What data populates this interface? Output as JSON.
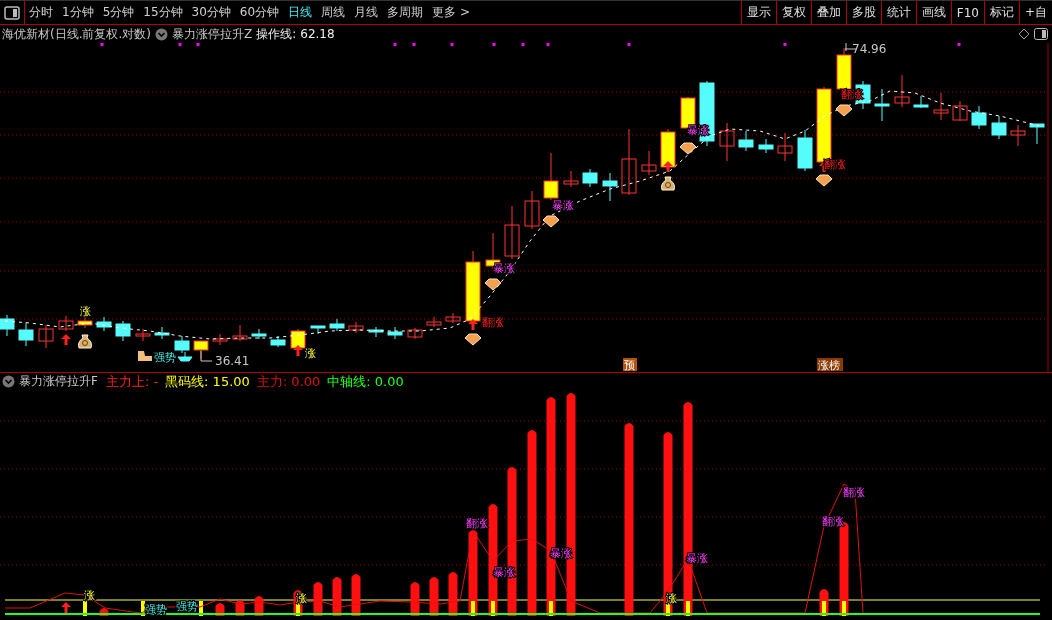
{
  "toolbar": {
    "tabs": [
      {
        "label": "分时",
        "selected": false
      },
      {
        "label": "1分钟",
        "selected": false
      },
      {
        "label": "5分钟",
        "selected": false
      },
      {
        "label": "15分钟",
        "selected": false
      },
      {
        "label": "30分钟",
        "selected": false
      },
      {
        "label": "60分钟",
        "selected": false
      },
      {
        "label": "日线",
        "selected": true
      },
      {
        "label": "周线",
        "selected": false
      },
      {
        "label": "月线",
        "selected": false
      },
      {
        "label": "多周期",
        "selected": false
      },
      {
        "label": "更多 >",
        "selected": false
      }
    ],
    "buttons": [
      "显示",
      "复权",
      "叠加",
      "多股",
      "统计",
      "画线",
      "F10",
      "标记",
      "+自"
    ]
  },
  "main_chart": {
    "title": "海优新材(日线.前复权.对数)",
    "indicator": "暴力涨停拉升Z",
    "reading_label": "操作线:",
    "reading_value": "62.18",
    "high_label": "74.96",
    "low_label": "36.41",
    "signals": [
      {
        "text": "涨",
        "kind": "rise"
      },
      {
        "text": "强势",
        "kind": "strong"
      },
      {
        "text": "涨",
        "kind": "rise"
      },
      {
        "text": "翻涨",
        "kind": "flip"
      },
      {
        "text": "暴涨",
        "kind": "surge"
      },
      {
        "text": "暴涨",
        "kind": "surge"
      },
      {
        "text": "暴涨",
        "kind": "surge"
      },
      {
        "text": "翻涨",
        "kind": "flip"
      },
      {
        "text": "翻涨",
        "kind": "flip"
      }
    ],
    "tags": [
      "预",
      "涨榜"
    ]
  },
  "indicator_panel": {
    "title": "暴力涨停拉升F",
    "readings": [
      {
        "label": "主力上:",
        "value": "-",
        "color": "#ff2020"
      },
      {
        "label": "黑码线:",
        "value": "15.00",
        "color": "#ffff00"
      },
      {
        "label": "主力:",
        "value": "0.00",
        "color": "#e01010"
      },
      {
        "label": "中轴线:",
        "value": "0.00",
        "color": "#20ff20"
      }
    ],
    "signals": [
      {
        "text": "涨",
        "kind": "rise"
      },
      {
        "text": "强势",
        "kind": "strong"
      },
      {
        "text": "强势",
        "kind": "strong"
      },
      {
        "text": "涨",
        "kind": "rise"
      },
      {
        "text": "翻涨",
        "kind": "flip"
      },
      {
        "text": "暴涨",
        "kind": "surge"
      },
      {
        "text": "暴涨",
        "kind": "surge"
      },
      {
        "text": "涨",
        "kind": "rise"
      },
      {
        "text": "暴涨",
        "kind": "surge"
      },
      {
        "text": "翻涨",
        "kind": "flip"
      },
      {
        "text": "翻涨",
        "kind": "flip"
      }
    ]
  }
}
